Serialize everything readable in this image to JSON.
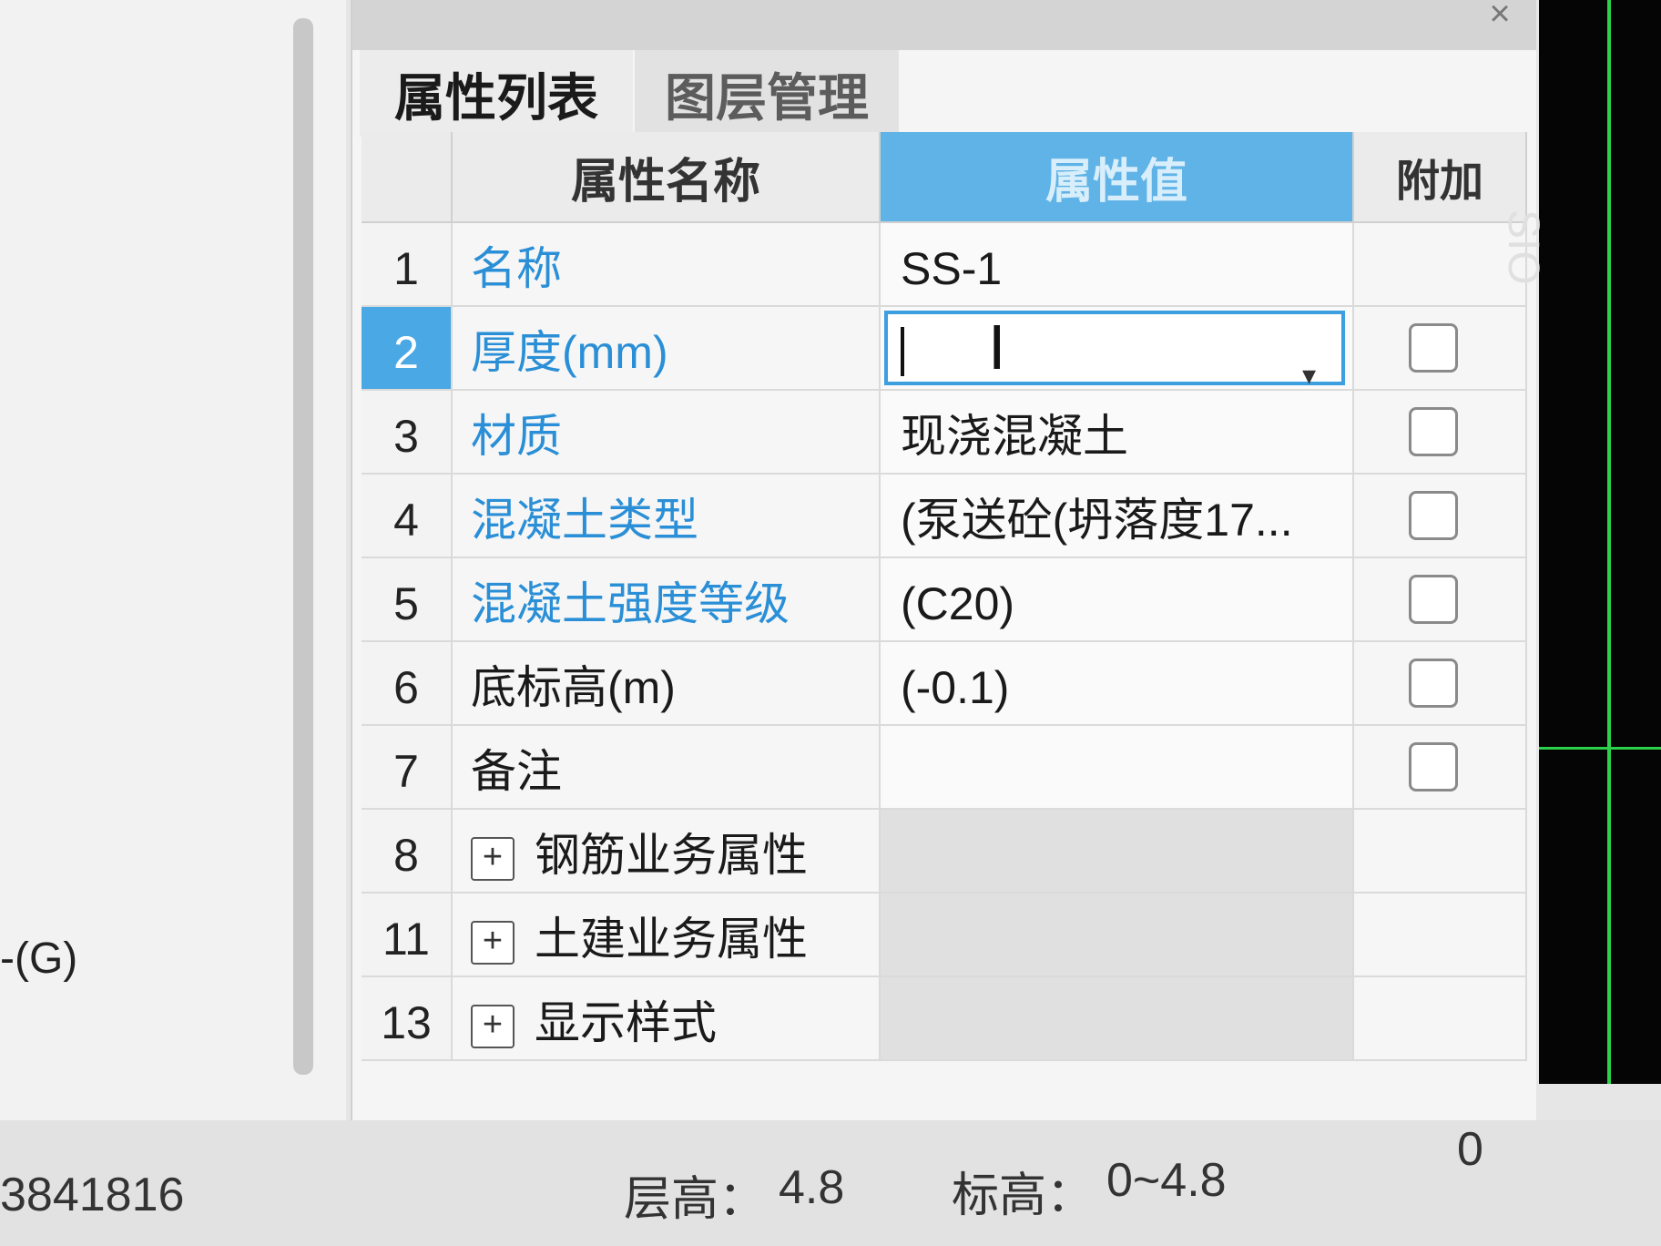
{
  "left_panel": {
    "label": "-(G)"
  },
  "dialog": {
    "close_glyph": "×",
    "tabs": [
      {
        "label": "属性列表",
        "active": true
      },
      {
        "label": "图层管理",
        "active": false
      }
    ],
    "columns": {
      "num": "",
      "name": "属性名称",
      "value": "属性值",
      "add": "附加"
    },
    "rows": [
      {
        "num": "1",
        "name": "名称",
        "value": "SS-1",
        "name_blue": true,
        "checkbox": false
      },
      {
        "num": "2",
        "name": "厚度(mm)",
        "value": "",
        "name_blue": true,
        "checkbox": true,
        "selected": true,
        "editing": true
      },
      {
        "num": "3",
        "name": "材质",
        "value": "现浇混凝土",
        "name_blue": true,
        "checkbox": true
      },
      {
        "num": "4",
        "name": "混凝土类型",
        "value": "(泵送砼(坍落度17...",
        "name_blue": true,
        "checkbox": true
      },
      {
        "num": "5",
        "name": "混凝土强度等级",
        "value": "(C20)",
        "name_blue": true,
        "checkbox": true
      },
      {
        "num": "6",
        "name": "底标高(m)",
        "value": "(-0.1)",
        "name_blue": false,
        "checkbox": true
      },
      {
        "num": "7",
        "name": "备注",
        "value": "",
        "name_blue": false,
        "checkbox": true
      },
      {
        "num": "8",
        "name": "钢筋业务属性",
        "value": "",
        "expandable": true
      },
      {
        "num": "11",
        "name": "土建业务属性",
        "value": "",
        "expandable": true
      },
      {
        "num": "13",
        "name": "显示样式",
        "value": "",
        "expandable": true
      }
    ],
    "expand_glyph": "+",
    "dropdown_glyph": "▾"
  },
  "canvas": {
    "text": "SIO"
  },
  "status": {
    "coord": "3841816",
    "floor_height_label": "层高：",
    "floor_height": "4.8",
    "elevation_label": "标高：",
    "elevation": "0~4.8",
    "extra": "0"
  },
  "colors": {
    "accent": "#4aa8e4",
    "blue_text": "#2a8fd6",
    "green_axis": "#2bd14a"
  }
}
